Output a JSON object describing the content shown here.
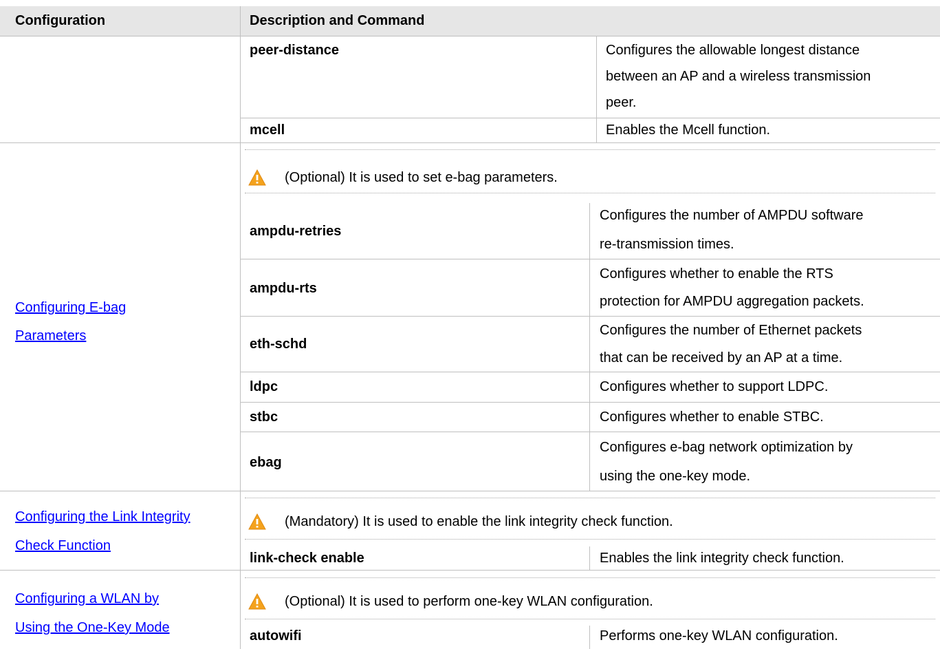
{
  "header": {
    "configuration": "Configuration",
    "description": "Description and Command"
  },
  "rows": [
    {
      "command": "peer-distance",
      "desc": [
        "Configures the allowable longest distance",
        "between an AP and a wireless transmission",
        "peer."
      ]
    },
    {
      "command": "mcell",
      "desc": [
        "Enables the Mcell function."
      ]
    }
  ],
  "ebag": {
    "link": [
      "Configuring E-bag ",
      "Parameters"
    ],
    "note": "(Optional) It is used to set e-bag parameters.",
    "rows": [
      {
        "command": "ampdu-retries",
        "desc": [
          "Configures the number of AMPDU software",
          "re-transmission times."
        ]
      },
      {
        "command": "ampdu-rts",
        "desc": [
          "Configures whether to enable the RTS",
          "protection for AMPDU aggregation packets."
        ]
      },
      {
        "command": "eth-schd",
        "desc": [
          "Configures the number of Ethernet packets",
          "that can be received by an AP at a time."
        ]
      },
      {
        "command": "ldpc",
        "desc": [
          "Configures whether to support LDPC."
        ]
      },
      {
        "command": "stbc",
        "desc": [
          "Configures whether to enable STBC."
        ]
      },
      {
        "command": "ebag",
        "desc": [
          "Configures e-bag network optimization by",
          "using the one-key mode."
        ]
      }
    ]
  },
  "link_check": {
    "link": [
      "Configuring the Link Integrity",
      "Check Function"
    ],
    "note": "(Mandatory) It is used to enable the link integrity check function.",
    "rows": [
      {
        "command": "link-check enable",
        "desc": [
          "Enables the link integrity check function."
        ]
      }
    ]
  },
  "wlan": {
    "link": [
      "Configuring a WLAN by ",
      "Using the One-Key Mode"
    ],
    "note": "(Optional) It is used to perform one-key WLAN configuration.",
    "rows": [
      {
        "command": "autowifi",
        "desc": [
          "Performs one-key WLAN configuration."
        ]
      }
    ]
  },
  "icon": "warning-triangle-icon",
  "colors": {
    "header_bg": "#e6e6e6",
    "link": "#0000ff",
    "warning": "#f4a21d"
  }
}
